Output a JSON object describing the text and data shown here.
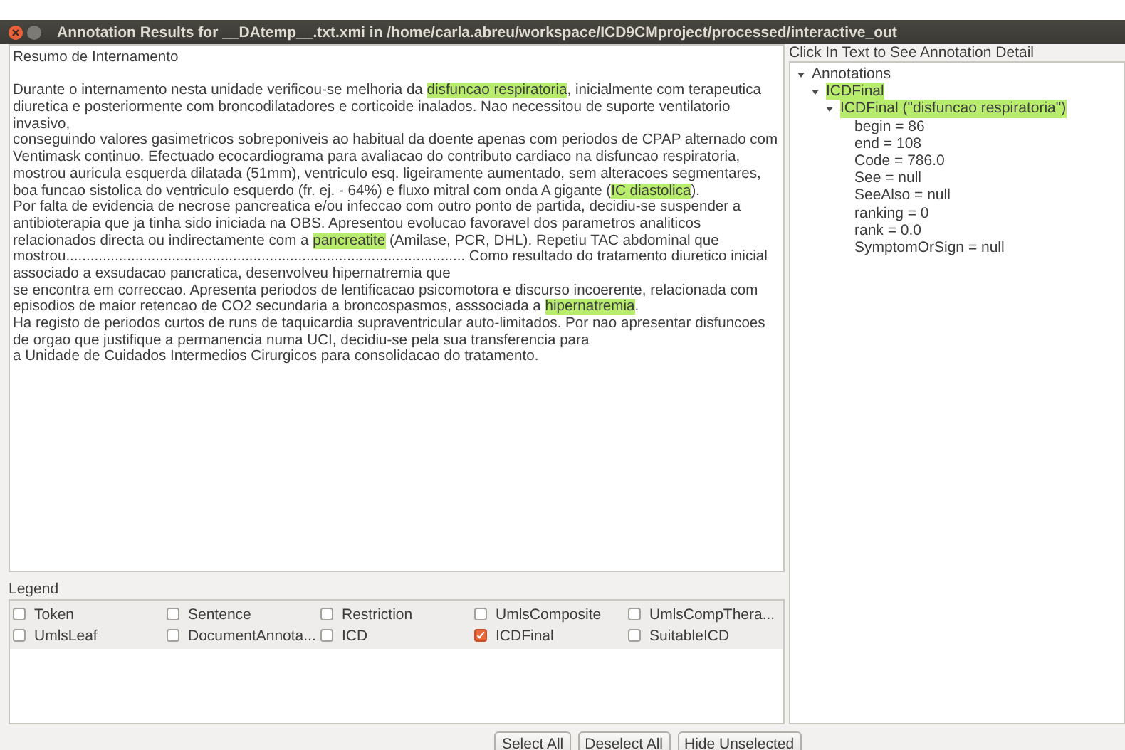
{
  "window": {
    "title": "Annotation Results for __DAtemp__.txt.xmi in /home/carla.abreu/workspace/ICD9CMproject/processed/interactive_out"
  },
  "document": {
    "heading": "Resumo de Internamento",
    "lines": [
      [
        {
          "text": "Durante o internamento nesta unidade verificou-se melhoria da ",
          "highlighted": false
        },
        {
          "text": "disfuncao respiratoria",
          "highlighted": true
        },
        {
          "text": ", inicialmente com terapeutica",
          "highlighted": false
        }
      ],
      [
        {
          "text": "diuretica e posteriormente com broncodilatadores e corticoide inalados. Nao necessitou de suporte ventilatorio",
          "highlighted": false
        }
      ],
      [
        {
          "text": "invasivo,",
          "highlighted": false
        }
      ],
      [
        {
          "text": "conseguindo valores gasimetricos sobreponiveis ao habitual da doente apenas com periodos de CPAP alternado com",
          "highlighted": false
        }
      ],
      [
        {
          "text": "Ventimask continuo. Efectuado ecocardiograma para avaliacao do contributo cardiaco na disfuncao respiratoria,",
          "highlighted": false
        }
      ],
      [
        {
          "text": "mostrou auricula esquerda dilatada (51mm), ventriculo esq. ligeiramente aumentado, sem alteracoes segmentares,",
          "highlighted": false
        }
      ],
      [
        {
          "text": "boa funcao sistolica do ventriculo esquerdo (fr. ej. - 64%) e fluxo mitral com onda A gigante (",
          "highlighted": false
        },
        {
          "text": "IC diastolica",
          "highlighted": true
        },
        {
          "text": ").",
          "highlighted": false
        }
      ],
      [
        {
          "text": "Por falta de evidencia de necrose pancreatica e/ou infeccao com outro ponto de partida, decidiu-se suspender a",
          "highlighted": false
        }
      ],
      [
        {
          "text": "antibioterapia que ja tinha sido iniciada na OBS. Apresentou evolucao favoravel dos parametros analiticos",
          "highlighted": false
        }
      ],
      [
        {
          "text": "relacionados directa ou indirectamente com a ",
          "highlighted": false
        },
        {
          "text": "pancreatite",
          "highlighted": true
        },
        {
          "text": " (Amilase, PCR, DHL). Repetiu TAC abdominal que",
          "highlighted": false
        }
      ],
      [
        {
          "text": "mostrou.................................................................................................. Como resultado do tratamento diuretico inicial",
          "highlighted": false
        }
      ],
      [
        {
          "text": "associado a exsudacao pancratica, desenvolveu hipernatremia que",
          "highlighted": false
        }
      ],
      [
        {
          "text": "se encontra em correccao. Apresenta periodos de lentificacao psicomotora e discurso incoerente, relacionada com",
          "highlighted": false
        }
      ],
      [
        {
          "text": "episodios de maior retencao de CO2 secundaria a broncospasmos, asssociada a ",
          "highlighted": false
        },
        {
          "text": "hipernatremia",
          "highlighted": true
        },
        {
          "text": ".",
          "highlighted": false
        }
      ],
      [
        {
          "text": "Ha registo de periodos curtos de runs de taquicardia supraventricular auto-limitados. Por nao apresentar disfuncoes",
          "highlighted": false
        }
      ],
      [
        {
          "text": "de orgao que justifique a permanencia numa UCI, decidiu-se pela sua transferencia para",
          "highlighted": false
        }
      ],
      [
        {
          "text": "a Unidade de Cuidados Intermedios Cirurgicos para consolidacao do tratamento.",
          "highlighted": false
        }
      ]
    ]
  },
  "legend": {
    "title": "Legend",
    "items": [
      {
        "label": "Token",
        "checked": false
      },
      {
        "label": "Sentence",
        "checked": false
      },
      {
        "label": "Restriction",
        "checked": false
      },
      {
        "label": "UmlsComposite",
        "checked": false
      },
      {
        "label": "UmlsCompThera...",
        "checked": false
      },
      {
        "label": "UmlsLeaf",
        "checked": false
      },
      {
        "label": "DocumentAnnota...",
        "checked": false
      },
      {
        "label": "ICD",
        "checked": false
      },
      {
        "label": "ICDFinal",
        "checked": true
      },
      {
        "label": "SuitableICD",
        "checked": false
      }
    ]
  },
  "detail": {
    "title": "Click In Text to See Annotation Detail",
    "tree": [
      {
        "label": "Annotations",
        "expanded": true,
        "highlighted": false,
        "children": [
          {
            "label": "ICDFinal",
            "expanded": true,
            "highlighted": true,
            "children": [
              {
                "label": "ICDFinal (\"disfuncao respiratoria\")",
                "expanded": true,
                "highlighted": true,
                "children": [
                  {
                    "label": "begin = 86"
                  },
                  {
                    "label": "end = 108"
                  },
                  {
                    "label": "Code = 786.0"
                  },
                  {
                    "label": "See = null"
                  },
                  {
                    "label": "SeeAlso = null"
                  },
                  {
                    "label": "ranking = 0"
                  },
                  {
                    "label": "rank = 0.0"
                  },
                  {
                    "label": "SymptomOrSign = null"
                  }
                ]
              }
            ]
          }
        ]
      }
    ]
  },
  "buttons": [
    "Select All",
    "Deselect All",
    "Hide Unselected"
  ]
}
